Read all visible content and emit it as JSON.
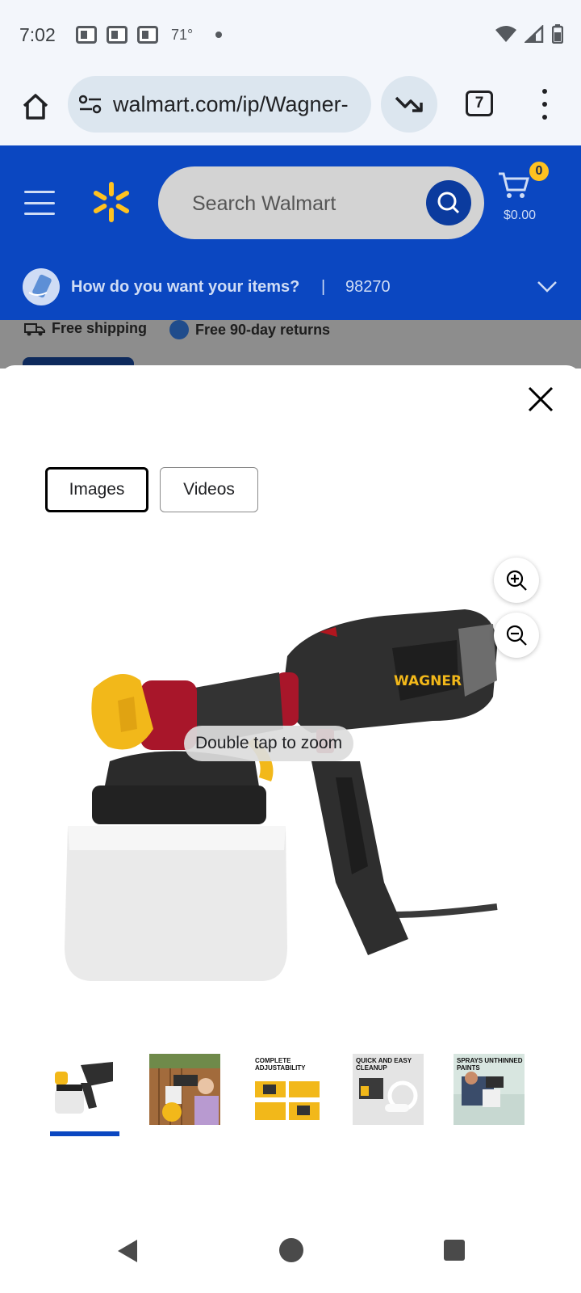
{
  "status_bar": {
    "time": "7:02",
    "temperature": "71°",
    "icons": [
      "news-icon",
      "news-icon",
      "news-icon",
      "wifi-icon",
      "signal-icon",
      "battery-icon"
    ]
  },
  "browser": {
    "url": "walmart.com/ip/Wagner-",
    "tab_count": "7"
  },
  "walmart": {
    "search_placeholder": "Search Walmart",
    "cart_count": "0",
    "cart_total": "$0.00",
    "delivery_prompt": "How do you want your items?",
    "delivery_separator": "|",
    "zip": "98270",
    "perk_shipping": "Free shipping",
    "perk_returns": "Free 90-day returns"
  },
  "modal": {
    "tabs": [
      {
        "label": "Images",
        "active": true
      },
      {
        "label": "Videos",
        "active": false
      }
    ],
    "zoom_hint": "Double tap to zoom",
    "product_brand": "WAGNER",
    "thumbnails": [
      {
        "caption": ""
      },
      {
        "caption": ""
      },
      {
        "caption": "COMPLETE ADJUSTABILITY"
      },
      {
        "caption": "QUICK AND EASY CLEANUP"
      },
      {
        "caption": "SPRAYS UNTHINNED PAINTS"
      }
    ]
  },
  "colors": {
    "walmart_blue": "#0b47c1",
    "spark_yellow": "#ffc220",
    "selected_underline": "#0b47c1"
  }
}
